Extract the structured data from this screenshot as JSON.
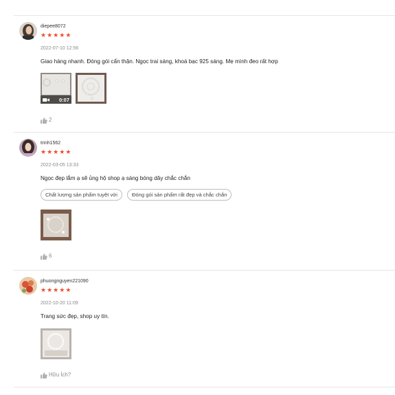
{
  "reviews": [
    {
      "username": "diepee8072",
      "stars": [
        "★",
        "★",
        "★",
        "★",
        "★"
      ],
      "date": "2022-07-10 12:56",
      "comment": "Giao hàng nhanh. Đóng gói cẩn thận. Ngọc trai sáng, khoá bạc 925 sáng. Mẹ mình đeo rất hợp",
      "video_duration": "0:07",
      "likes": "2"
    },
    {
      "username": "trinh1562",
      "stars": [
        "★",
        "★",
        "★",
        "★",
        "★"
      ],
      "date": "2022-03-05 13:33",
      "comment": "Ngọc đẹp lắm ạ sẽ ủng hộ shop ạ sáng bóng dây chắc chắn",
      "tags": [
        "Chất lượng sản phẩm tuyệt vời",
        "Đóng gói sản phẩm rất đẹp và chắc chắn"
      ],
      "likes": "6"
    },
    {
      "username": "phuongnguyen221090",
      "stars": [
        "★",
        "★",
        "★",
        "★",
        "★"
      ],
      "date": "2022-10-20 11:09",
      "comment": "Trang sức đẹp, shop uy tín.",
      "likes": "Hữu Ích?"
    }
  ],
  "colors": {
    "star": "#ee4d2d",
    "muted": "#8a8a8a",
    "divider": "#e6e6e6"
  }
}
